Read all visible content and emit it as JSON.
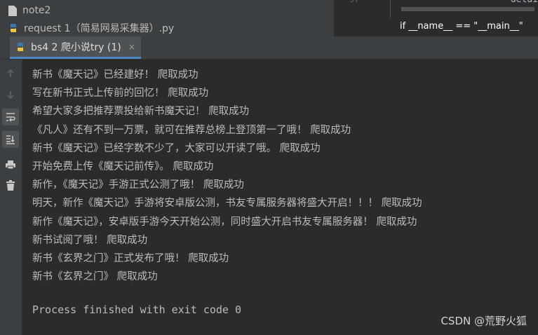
{
  "project_files": [
    {
      "name": "note2",
      "icon": "document-icon"
    },
    {
      "name": "request 1（简易网易采集器）.py",
      "icon": "python-file-icon"
    }
  ],
  "editor_preview": {
    "line_number": "97",
    "code_snippet": "detai",
    "main_line": "if __name__ == \"__main__\""
  },
  "run_tab": {
    "label": "bs4 2 爬小说try (1)",
    "close": "×",
    "icon": "python-icon"
  },
  "toolbar_icons": [
    "arrow-up-icon",
    "arrow-down-icon",
    "soft-wrap-icon",
    "scroll-to-end-icon",
    "print-icon",
    "trash-icon"
  ],
  "output_lines": [
    "新书《魔天记》已经建好！  爬取成功",
    "写在新书正式上传前的回忆！  爬取成功",
    "希望大家多把推荐票投给新书魔天记！  爬取成功",
    "《凡人》还有不到一万票，就可在推荐总榜上登顶第一了哦！  爬取成功",
    "新书《魔天记》已经字数不少了，大家可以开读了哦。  爬取成功",
    "开始免费上传《魔天记前传》。  爬取成功",
    "新作，《魔天记》手游正式公测了哦！  爬取成功",
    "明天，新作《魔天记》手游将安卓版公测，书友专属服务器将盛大开启！！！  爬取成功",
    "新作《魔天记》，安卓版手游今天开始公测，同时盛大开启书友专属服务器！  爬取成功",
    "新书试阅了哦！  爬取成功",
    "新书《玄界之门》正式发布了哦！  爬取成功",
    "新书《玄界之门》 爬取成功"
  ],
  "process_status": "Process finished with exit code 0",
  "watermark": "CSDN @荒野火狐",
  "colors": {
    "background": "#2b2b2b",
    "panel": "#3c3f41",
    "text": "#bbbbbb",
    "accent": "#4a88c7"
  }
}
